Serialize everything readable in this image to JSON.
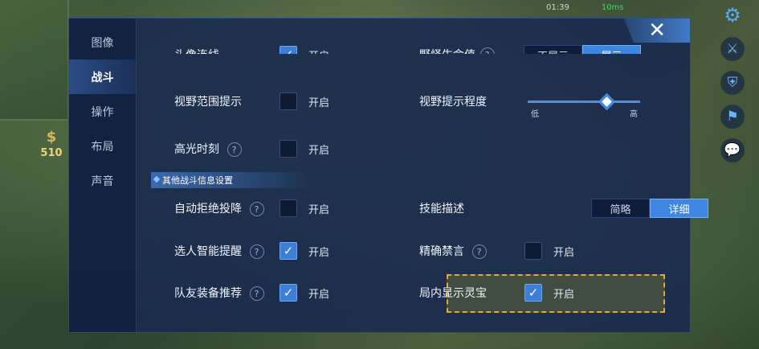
{
  "status": {
    "time": "01:39",
    "network": "10ms"
  },
  "hud": {
    "gold": "510"
  },
  "tabs": [
    {
      "label": "图像",
      "active": false
    },
    {
      "label": "战斗",
      "active": true
    },
    {
      "label": "操作",
      "active": false
    },
    {
      "label": "布局",
      "active": false
    },
    {
      "label": "声音",
      "active": false
    }
  ],
  "close_label": "✕",
  "settings": {
    "top_partial_left": {
      "label": "头像连线",
      "checked": true,
      "value_label": "开启"
    },
    "top_partial_right": {
      "label": "野怪生命值",
      "options": [
        "不展示",
        "展示"
      ],
      "selected": "展示"
    },
    "vision_hint": {
      "label": "视野范围提示",
      "checked": false,
      "value_label": "开启"
    },
    "vision_level": {
      "label": "视野提示程度",
      "min_label": "低",
      "max_label": "高",
      "value_fraction": 0.7
    },
    "highlight_moment": {
      "label": "高光时刻",
      "checked": false,
      "value_label": "开启"
    },
    "section_other": "其他战斗信息设置",
    "auto_reject_surrender": {
      "label": "自动拒绝投降",
      "checked": false,
      "value_label": "开启"
    },
    "skill_description": {
      "label": "技能描述",
      "options": [
        "简略",
        "详细"
      ],
      "selected": "详细"
    },
    "smart_pick_reminder": {
      "label": "选人智能提醒",
      "checked": true,
      "value_label": "开启"
    },
    "precise_mute": {
      "label": "精确禁言",
      "checked": false,
      "value_label": "开启"
    },
    "teammate_equipment": {
      "label": "队友装备推荐",
      "checked": true,
      "value_label": "开启"
    },
    "show_lingbao": {
      "label": "局内显示灵宝",
      "checked": true,
      "value_label": "开启"
    }
  },
  "icons": {
    "help": "?",
    "check": "✓",
    "gear": "⚙",
    "sword": "⚔",
    "shield": "⛨",
    "flag": "⚑",
    "chat": "💬",
    "money_bag": "$"
  },
  "colors": {
    "accent": "#3e86e0",
    "highlight_border": "#e8a82a"
  }
}
